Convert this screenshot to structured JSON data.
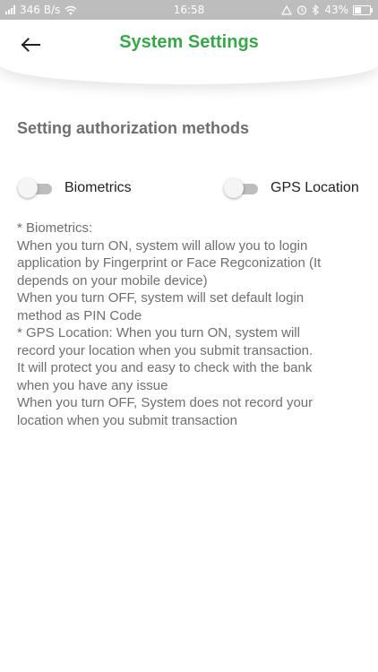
{
  "status_bar": {
    "network_speed": "346 B/s",
    "time": "16:58",
    "battery": "43%",
    "battery_level": 0.43
  },
  "header": {
    "title": "System Settings",
    "back_icon": "arrow-left-icon",
    "title_color": "#3aa64a"
  },
  "section": {
    "title": "Setting authorization methods"
  },
  "toggles": [
    {
      "label": "Biometrics",
      "on": false
    },
    {
      "label": "GPS Location",
      "on": false
    }
  ],
  "info_lines": [
    "* Biometrics:",
    "When you turn ON, system will allow you to login",
    "application by Fingerprint or Face Regconization (It",
    "depends on your mobile device)",
    "When you turn OFF, system will set default login",
    "method as PIN Code",
    "* GPS Location: When you turn ON, system will",
    "record your location when you submit transaction.",
    "It will protect you and easy to check with the bank",
    "when you have any issue",
    "When you turn OFF, System does not record your",
    "location when you submit transaction"
  ]
}
